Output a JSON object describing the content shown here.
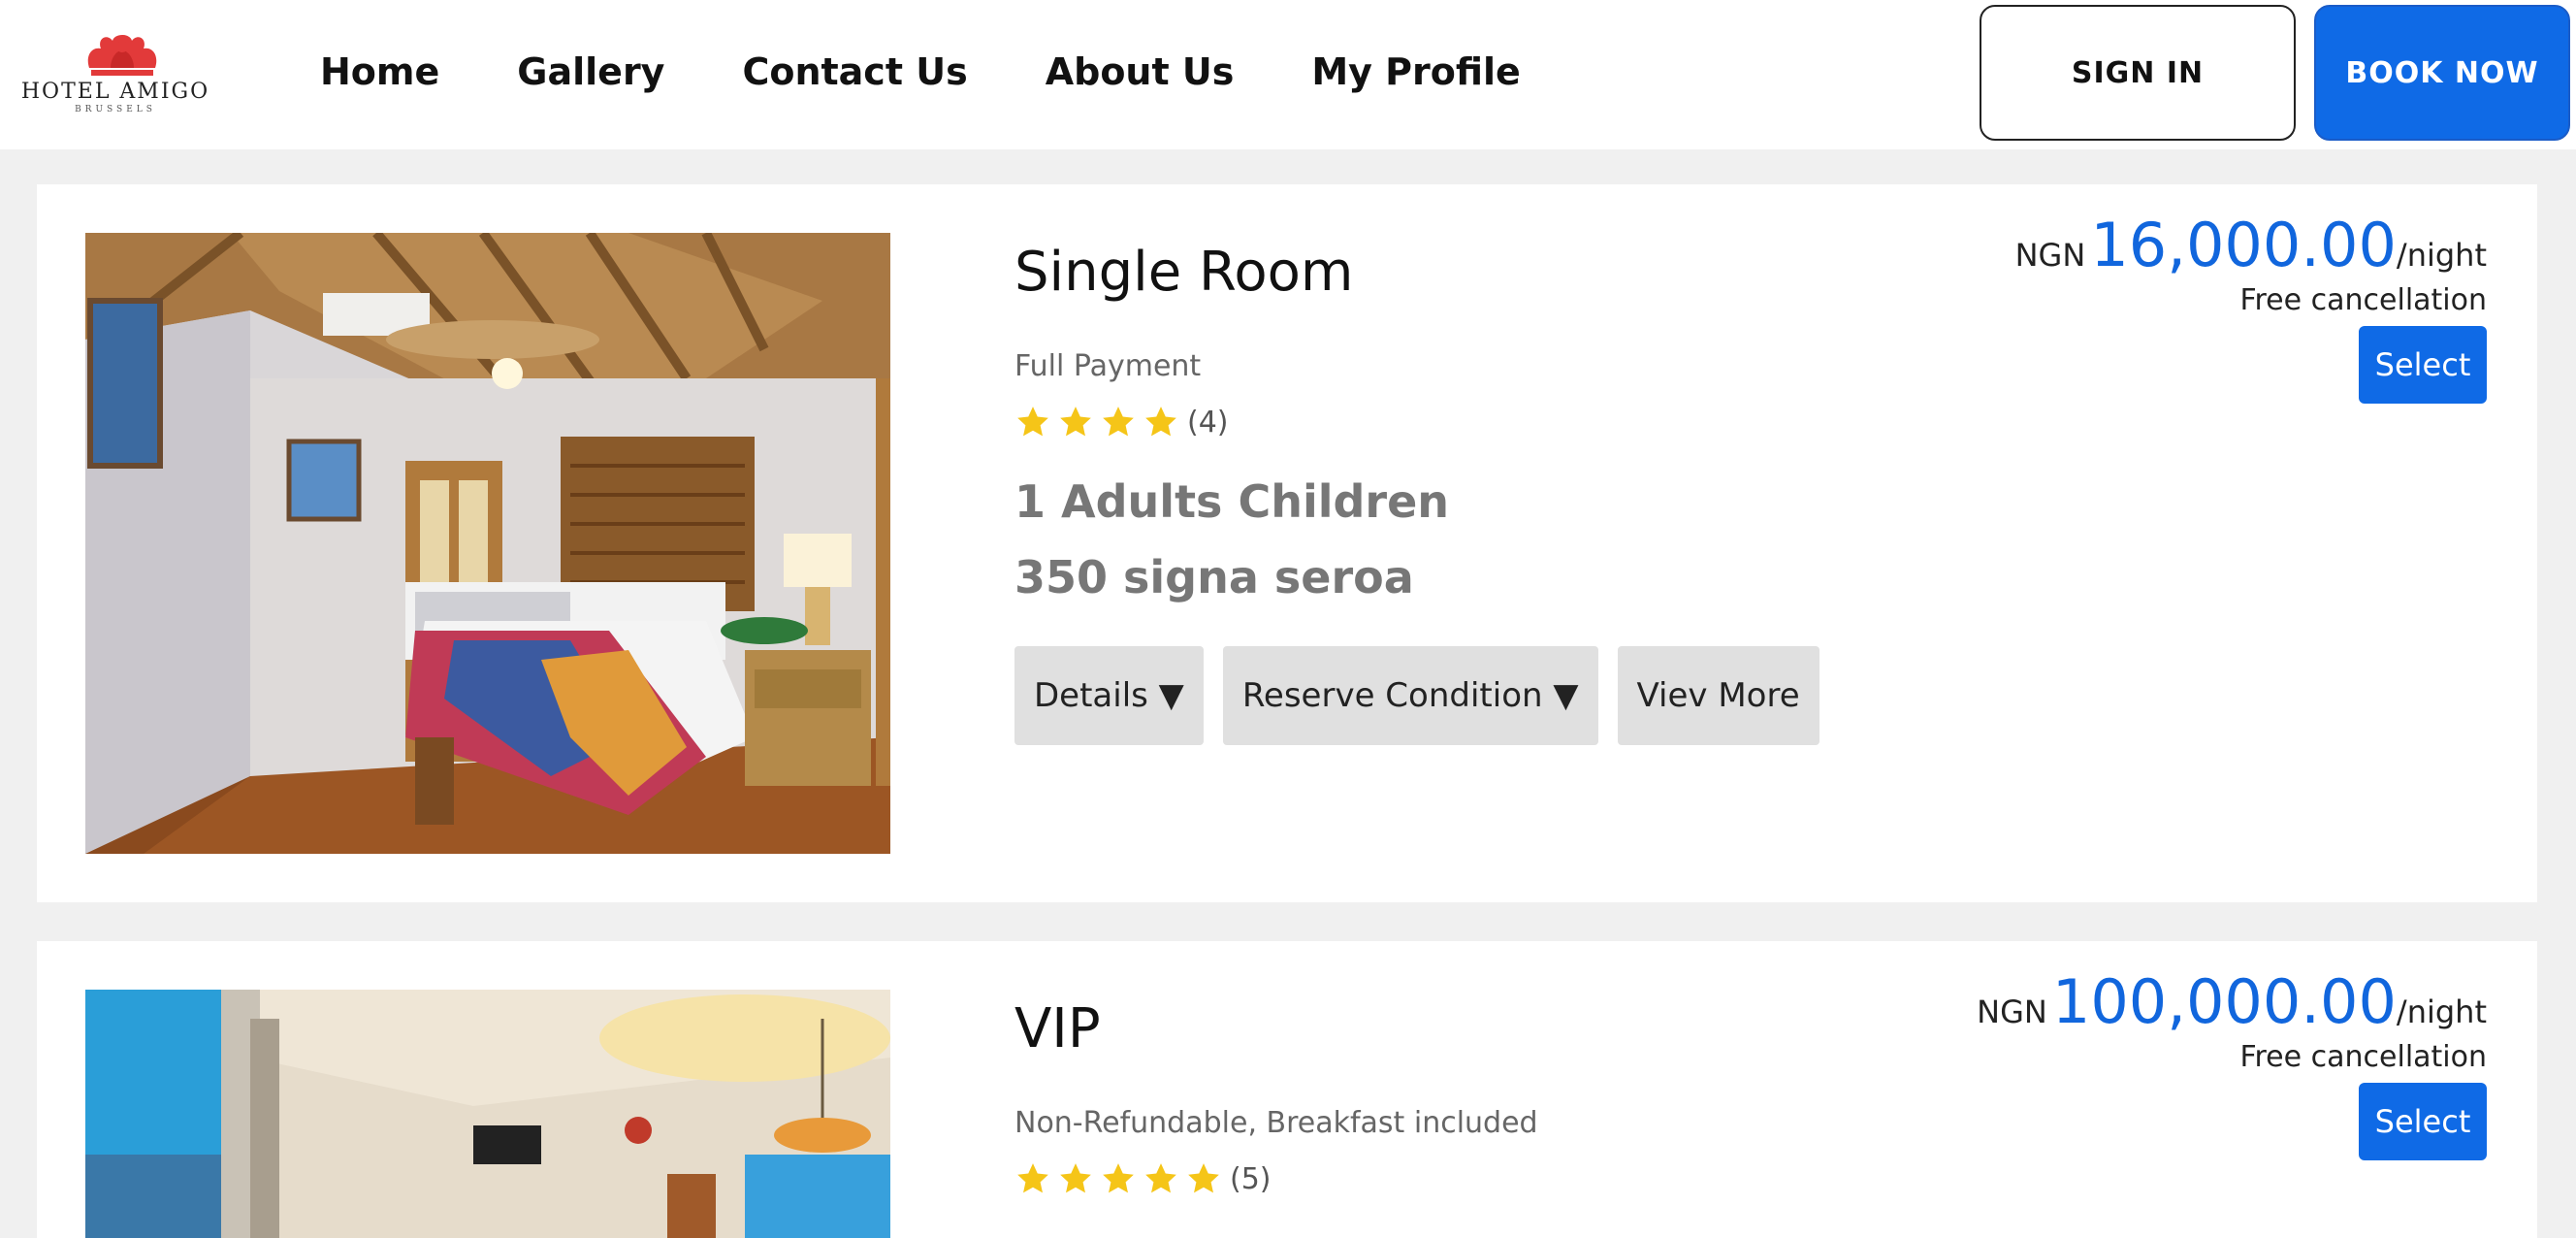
{
  "brand": {
    "name": "HOTEL AMIGO",
    "city": "BRUSSELS",
    "logo_color": "#e23a3a"
  },
  "nav": {
    "items": [
      "Home",
      "Gallery",
      "Contact Us",
      "About Us",
      "My Profile"
    ]
  },
  "header_actions": {
    "sign_in": "SIGN IN",
    "book_now": "BOOK NOW"
  },
  "colors": {
    "accent": "#0f6ae6",
    "star": "#f5c518"
  },
  "rooms": [
    {
      "title": "Single Room",
      "policy": "Full Payment",
      "stars": 4,
      "rating_count": "(4)",
      "capacity": "1 Adults Children",
      "size": "350 signa seroa",
      "currency": "NGN",
      "price": "16,000.00",
      "unit": "/night",
      "cancellation": "Free cancellation",
      "select_label": "Select",
      "actions": [
        "Details ▼",
        "Reserve Condition ▼",
        "Viev More"
      ]
    },
    {
      "title": "VIP",
      "policy": "Non-Refundable, Breakfast included",
      "stars": 5,
      "rating_count": "(5)",
      "currency": "NGN",
      "price": "100,000.00",
      "unit": "/night",
      "cancellation": "Free cancellation",
      "select_label": "Select"
    }
  ]
}
